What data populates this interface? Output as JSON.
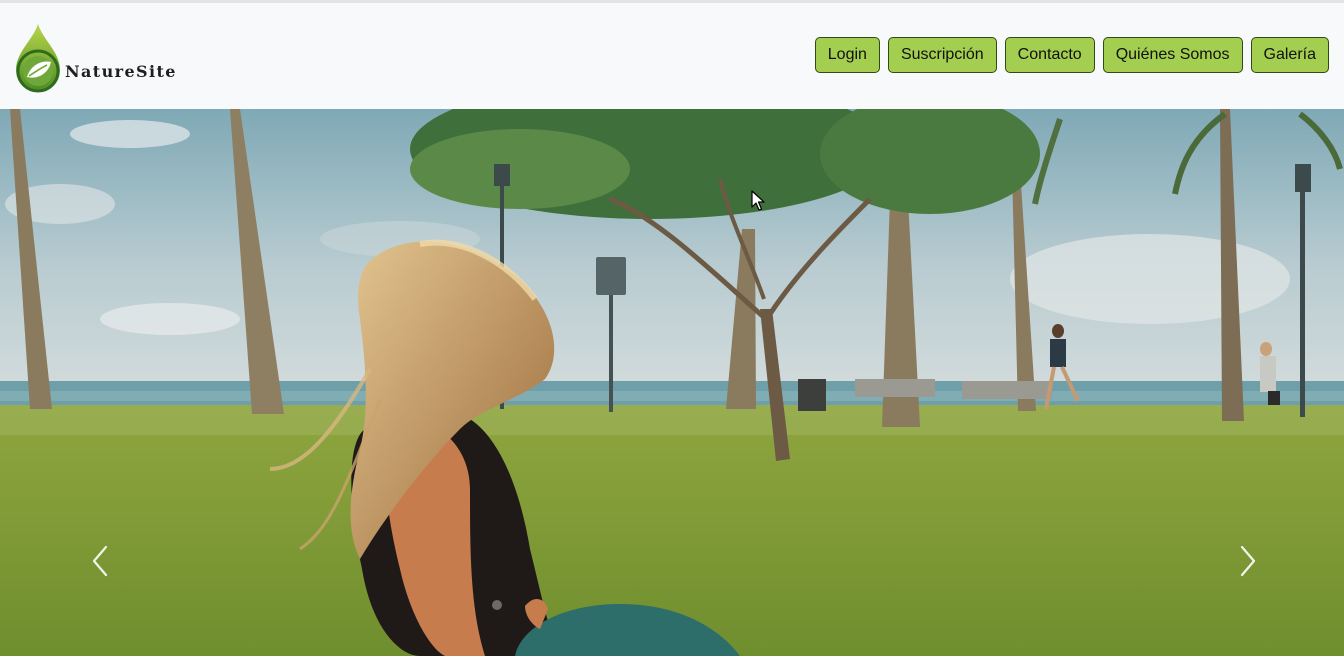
{
  "brand": {
    "name": "NatureSite",
    "logo_icon": "leaf-drop-icon"
  },
  "nav": {
    "items": [
      {
        "label": "Login"
      },
      {
        "label": "Suscripción"
      },
      {
        "label": "Contacto"
      },
      {
        "label": "Quiénes Somos"
      },
      {
        "label": "Galería"
      }
    ]
  },
  "carousel": {
    "prev_icon": "chevron-left-icon",
    "next_icon": "chevron-right-icon"
  },
  "colors": {
    "nav_button_bg": "#a3ce4f",
    "nav_button_border": "#2f4a14",
    "header_bg": "#f8f9fa"
  }
}
